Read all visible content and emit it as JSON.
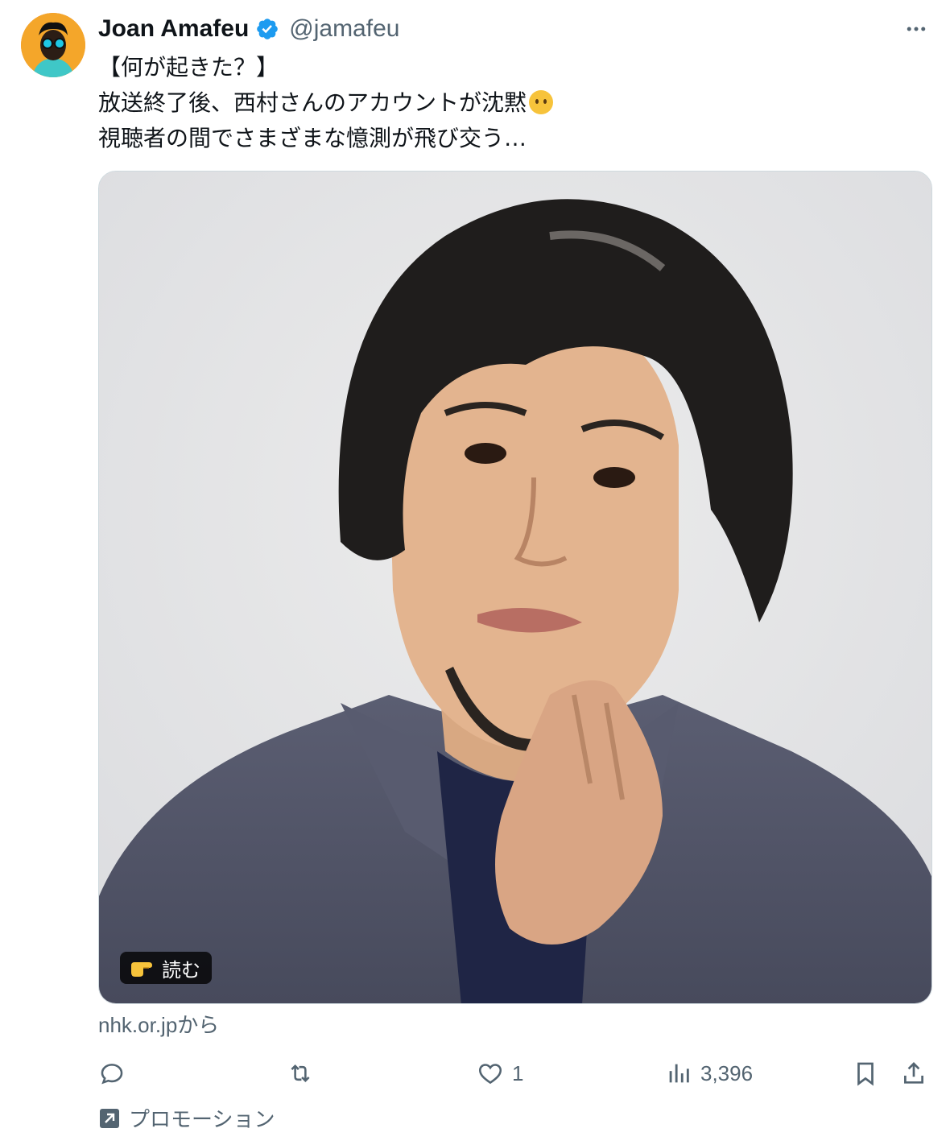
{
  "post": {
    "author": {
      "display_name": "Joan Amafeu",
      "handle": "@jamafeu",
      "verified": true
    },
    "text_lines": [
      "【何が起きた？】",
      "放送終了後、西村さんのアカウントが沈黙",
      "視聴者の間でさまざまな憶測が飛び交う…"
    ],
    "emoji": "neutral-face-no-mouth-emoji",
    "media": {
      "description_icon": "photo-of-man",
      "badge_label": "読む",
      "badge_icon": "pointing-right-hand-icon"
    },
    "source": "nhk.or.jpから",
    "actions": {
      "reply": {
        "icon": "reply-icon",
        "count": ""
      },
      "repost": {
        "icon": "repost-icon",
        "count": ""
      },
      "like": {
        "icon": "heart-icon",
        "count": "1"
      },
      "views": {
        "icon": "views-chart-icon",
        "count": "3,396"
      },
      "bookmark": {
        "icon": "bookmark-icon"
      },
      "share": {
        "icon": "share-icon"
      }
    },
    "promotion_label": "プロモーション"
  },
  "colors": {
    "text_primary": "#0f1419",
    "text_secondary": "#536471",
    "verified_blue": "#1d9bf0",
    "border": "#cfd9de"
  }
}
